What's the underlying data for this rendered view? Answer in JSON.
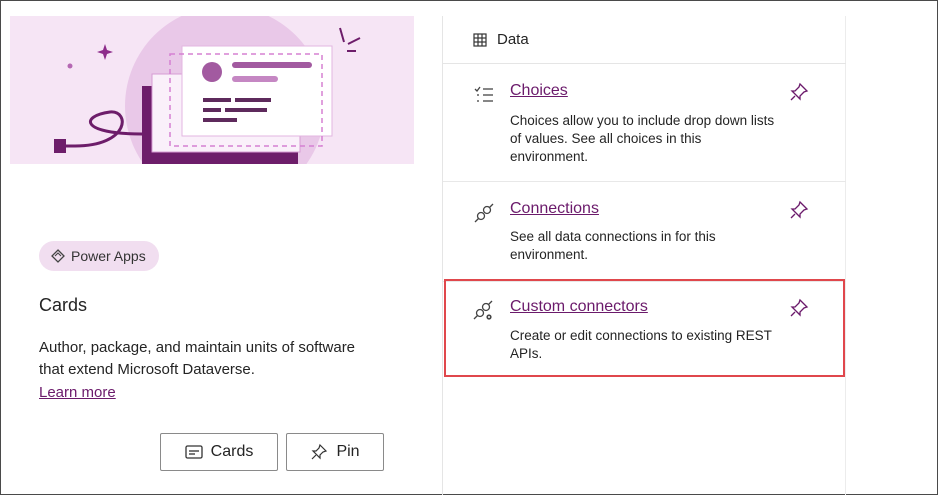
{
  "left_card": {
    "badge_label": "Power Apps",
    "title": "Cards",
    "description": "Author, package, and maintain units of software that extend Microsoft Dataverse.",
    "learn_more": "Learn more",
    "buttons": {
      "cards": "Cards",
      "pin": "Pin"
    }
  },
  "panel": {
    "header": "Data",
    "items": [
      {
        "title": "Choices",
        "description": "Choices allow you to include drop down lists of values. See all choices in this environment.",
        "icon": "choices-list-icon"
      },
      {
        "title": "Connections",
        "description": "See all data connections in for this environment.",
        "icon": "plug-connect-icon"
      },
      {
        "title": "Custom connectors",
        "description": "Create or edit connections to existing REST APIs.",
        "icon": "custom-connector-icon"
      }
    ]
  },
  "colors": {
    "accent": "#6b1a6b",
    "hero_bg": "#f6e5f5",
    "highlight": "#e0474c"
  }
}
